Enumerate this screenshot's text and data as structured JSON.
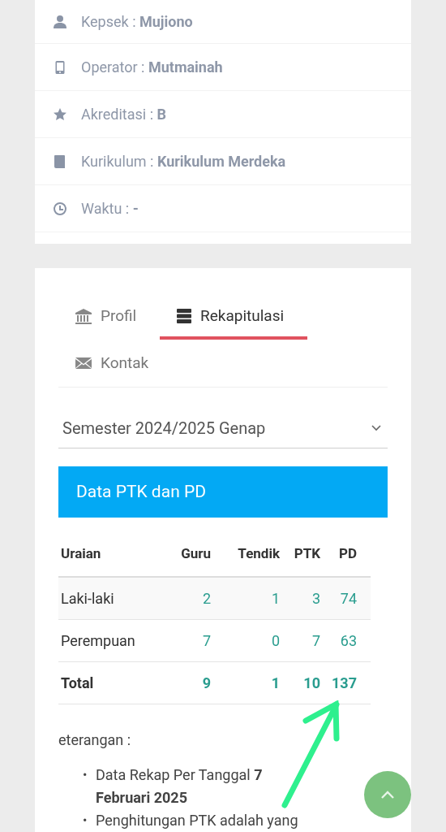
{
  "info_items": [
    {
      "text": "Kepsek : **Mujiono**"
    },
    {
      "text": "Operator : **Mutmainah**"
    },
    {
      "text": "Akreditasi : **B**"
    },
    {
      "text": "Kurikulum : **Kurikulum Merdeka**"
    },
    {
      "text": "Waktu : **-**"
    }
  ],
  "tabs": [
    {
      "label": "Profil",
      "selected": false
    },
    {
      "label": "Rekapitulasi",
      "selected": true
    },
    {
      "label": "Kontak",
      "selected": false
    }
  ],
  "semester_select": {
    "value": "Semester 2024/2025 Genap"
  },
  "panel": {
    "title": "Data PTK dan PD"
  },
  "table": {
    "columns": [
      "Uraian",
      "Guru",
      "Tendik",
      "PTK",
      "PD"
    ],
    "rows": [
      {
        "kind": "data",
        "cells": [
          "Laki-laki",
          "2",
          "1",
          "3",
          "74"
        ]
      },
      {
        "kind": "data",
        "cells": [
          "Perempuan",
          "7",
          "0",
          "7",
          "63"
        ]
      },
      {
        "kind": "total",
        "cells": [
          "Total",
          "9",
          "1",
          "10",
          "137"
        ]
      }
    ]
  },
  "notes": {
    "heading": "eterangan :",
    "items": [
      {
        "bullet": "•",
        "text": "Data Rekap Per Tanggal **7 Februari 2025**"
      },
      {
        "bullet": "•",
        "text": "Penghitungan PTK adalah yang"
      }
    ]
  }
}
